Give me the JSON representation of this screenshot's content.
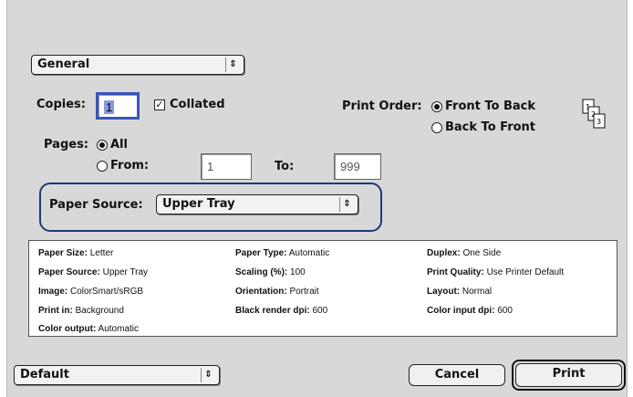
{
  "panel_menu": {
    "value": "General"
  },
  "copies": {
    "label": "Copies:",
    "value": "1",
    "collated_label": "Collated",
    "collated_checked": true
  },
  "print_order": {
    "label": "Print Order:",
    "options": [
      "Front To Back",
      "Back To Front"
    ],
    "selected": "Front To Back"
  },
  "pages": {
    "label": "Pages:",
    "all_label": "All",
    "from_label": "From:",
    "to_label": "To:",
    "from_value": "1",
    "to_value": "999",
    "selected": "All"
  },
  "paper_source": {
    "label": "Paper Source:",
    "value": "Upper Tray"
  },
  "summary": {
    "rows": [
      [
        {
          "k": "Paper Size:",
          "v": "Letter"
        },
        {
          "k": "Paper Type:",
          "v": "Automatic"
        },
        {
          "k": "Duplex:",
          "v": "One Side"
        }
      ],
      [
        {
          "k": "Paper Source:",
          "v": "Upper Tray"
        },
        {
          "k": "Scaling (%):",
          "v": "100"
        },
        {
          "k": "Print Quality:",
          "v": "Use Printer Default"
        }
      ],
      [
        {
          "k": "Image:",
          "v": "ColorSmart/sRGB"
        },
        {
          "k": "Orientation:",
          "v": "Portrait"
        },
        {
          "k": "Layout:",
          "v": "Normal"
        }
      ],
      [
        {
          "k": "Print in:",
          "v": "Background"
        },
        {
          "k": "Black render dpi:",
          "v": "600"
        },
        {
          "k": "Color input dpi:",
          "v": "600"
        }
      ],
      [
        {
          "k": "Color output:",
          "v": "Automatic"
        }
      ]
    ]
  },
  "presets": {
    "value": "Default"
  },
  "buttons": {
    "cancel": "Cancel",
    "print": "Print"
  },
  "colors": {
    "highlight": "#1a3a7a",
    "copies_field_focus": "#8899dd"
  }
}
